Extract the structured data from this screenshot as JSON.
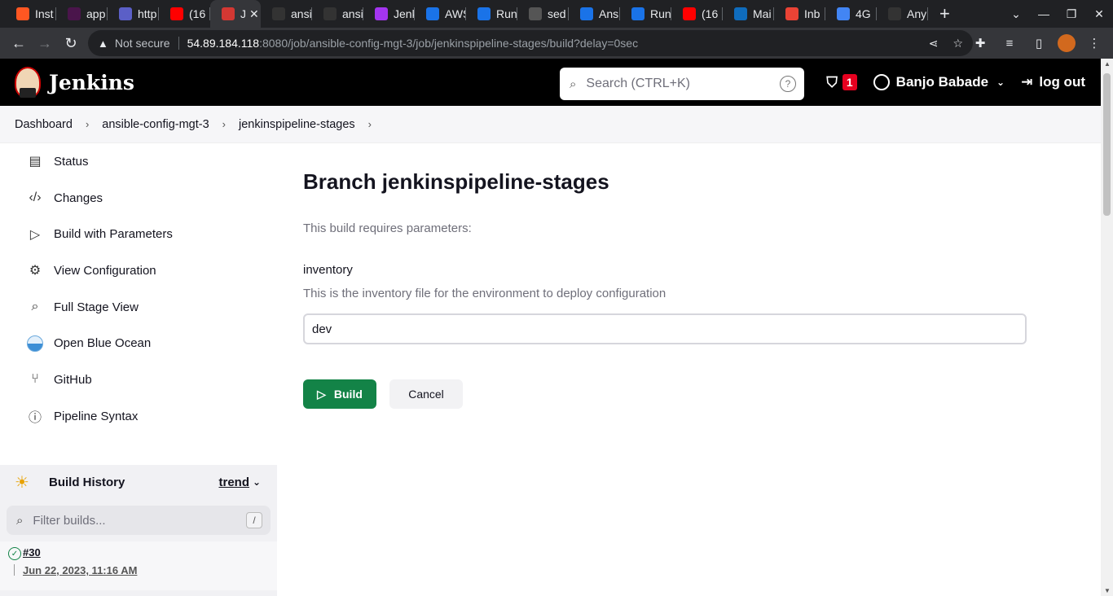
{
  "browser": {
    "tabs": [
      {
        "title": "Inst",
        "icon": "orange-square-icon",
        "color": "#ff5722"
      },
      {
        "title": "app",
        "icon": "slack-icon",
        "color": "#4a154b"
      },
      {
        "title": "http",
        "icon": "teams-icon",
        "color": "#5b5fc7"
      },
      {
        "title": "(16",
        "icon": "youtube-icon",
        "color": "#ff0000"
      },
      {
        "title": "J",
        "icon": "jenkins-icon",
        "color": "#d33833",
        "active": true
      },
      {
        "title": "ansi",
        "icon": "github-icon",
        "color": "#333333"
      },
      {
        "title": "ansi",
        "icon": "github-icon",
        "color": "#333333"
      },
      {
        "title": "Jenk",
        "icon": "udemy-icon",
        "color": "#a435f0"
      },
      {
        "title": "AWS",
        "icon": "devops-icon",
        "color": "#1a73e8"
      },
      {
        "title": "Run",
        "icon": "devops-icon",
        "color": "#1a73e8"
      },
      {
        "title": "sed",
        "icon": "linux-icon",
        "color": "#555555"
      },
      {
        "title": "Ans",
        "icon": "devops-icon",
        "color": "#1a73e8"
      },
      {
        "title": "Run",
        "icon": "devops-icon",
        "color": "#1a73e8"
      },
      {
        "title": "(16",
        "icon": "youtube-icon",
        "color": "#ff0000"
      },
      {
        "title": "Mai",
        "icon": "outlook-icon",
        "color": "#0f6cbd"
      },
      {
        "title": "Inb",
        "icon": "gmail-icon",
        "color": "#ea4335"
      },
      {
        "title": "4G",
        "icon": "google-icon",
        "color": "#4285f4"
      },
      {
        "title": "Any",
        "icon": "github-icon",
        "color": "#333333"
      }
    ],
    "omnibox": {
      "security": "Not secure",
      "host": "54.89.184.118",
      "path": ":8080/job/ansible-config-mgt-3/job/jenkinspipeline-stages/build?delay=0sec"
    }
  },
  "header": {
    "app_name": "Jenkins",
    "search_placeholder": "Search (CTRL+K)",
    "alert_count": "1",
    "user_name": "Banjo Babade",
    "logout_label": "log out"
  },
  "breadcrumb": [
    "Dashboard",
    "ansible-config-mgt-3",
    "jenkinspipeline-stages"
  ],
  "sidebar": {
    "tasks": [
      {
        "label": "Status",
        "icon": "document-icon"
      },
      {
        "label": "Changes",
        "icon": "code-icon"
      },
      {
        "label": "Build with Parameters",
        "icon": "play-icon"
      },
      {
        "label": "View Configuration",
        "icon": "gear-icon"
      },
      {
        "label": "Full Stage View",
        "icon": "search-icon"
      },
      {
        "label": "Open Blue Ocean",
        "icon": "blue-ocean-icon"
      },
      {
        "label": "GitHub",
        "icon": "branch-icon"
      },
      {
        "label": "Pipeline Syntax",
        "icon": "help-icon"
      }
    ]
  },
  "build_history": {
    "title": "Build History",
    "trend_label": "trend",
    "filter_placeholder": "Filter builds...",
    "filter_shortcut": "/",
    "builds": [
      {
        "number": "#30",
        "date": "Jun 22, 2023, 11:16 AM",
        "status": "success"
      }
    ]
  },
  "main": {
    "title": "Branch jenkinspipeline-stages",
    "requires_text": "This build requires parameters:",
    "param_name": "inventory",
    "param_description": "This is the inventory file for the environment to deploy configuration",
    "param_value": "dev",
    "build_label": "Build",
    "cancel_label": "Cancel"
  }
}
